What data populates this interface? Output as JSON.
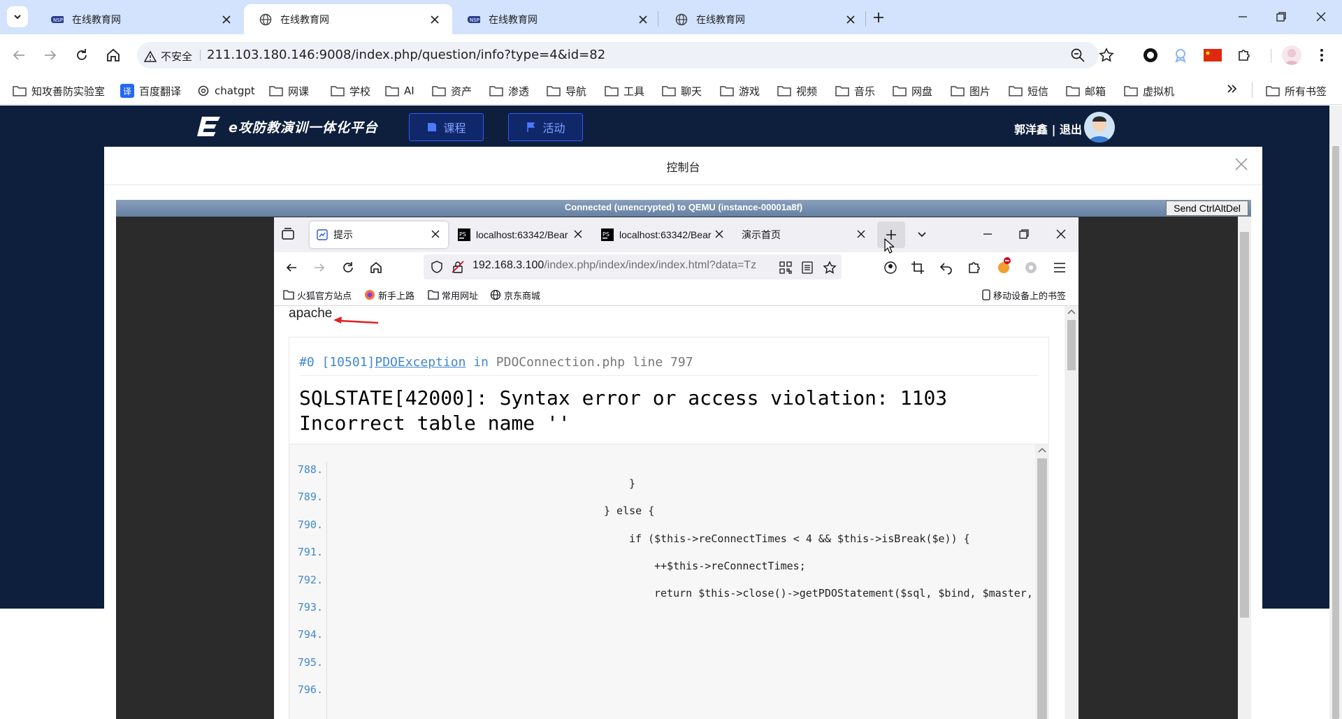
{
  "browser_tabs": [
    {
      "title": "在线教育网",
      "favicon": "nsp-logo-icon",
      "active": false
    },
    {
      "title": "在线教育网",
      "favicon": "globe-icon",
      "active": true
    },
    {
      "title": "在线教育网",
      "favicon": "nsp-logo-icon",
      "active": false
    },
    {
      "title": "在线教育网",
      "favicon": "globe-icon",
      "active": false
    }
  ],
  "address_bar": {
    "security_label": "不安全",
    "url": "211.103.180.146:9008/index.php/question/info?type=4&id=82"
  },
  "bookmarks": [
    "知攻善防实验室",
    "百度翻译",
    "chatgpt",
    "网课",
    "学校",
    "AI",
    "资产",
    "渗透",
    "导航",
    "工具",
    "聊天",
    "游戏",
    "视频",
    "音乐",
    "网盘",
    "图片",
    "短信",
    "邮箱",
    "虚拟机"
  ],
  "bookmarks_all_label": "所有书签",
  "site": {
    "logo_text": "e攻防教演训一体化平台",
    "nav": [
      "课程",
      "活动"
    ],
    "user": "郭洋鑫 | 退出"
  },
  "modal": {
    "title": "控制台"
  },
  "vnc": {
    "status": "Connected (unencrypted) to QEMU (instance-00001a8f)",
    "ctrl_alt_del_label": "Send CtrlAltDel"
  },
  "firefox": {
    "tabs": [
      "提示",
      "localhost:63342/Bear",
      "localhost:63342/Bear",
      "演示首页"
    ],
    "url_host": "192.168.3.100",
    "url_path": "/index.php/index/index/index.html?data=Tz",
    "bookmarks": [
      "火狐官方站点",
      "新手上路",
      "常用网址",
      "京东商城"
    ],
    "mobile_bookmarks_label": "移动设备上的书签"
  },
  "error_page": {
    "output": "apache",
    "exception_prefix": "#0 [10501]",
    "exception_class": "PDOException",
    "exception_in": "in",
    "exception_file": "PDOConnection.php line 797",
    "message_line1": "SQLSTATE[42000]: Syntax error or access violation: 1103",
    "message_line2": "Incorrect table name ''",
    "code_lines": [
      {
        "num": "788.",
        "text": "}",
        "indent": 3
      },
      {
        "num": "789.",
        "text": "",
        "indent": 0
      },
      {
        "num": "790.",
        "text": "} else {",
        "indent": 2
      },
      {
        "num": "791.",
        "text": "",
        "indent": 0
      },
      {
        "num": "792.",
        "text": "if ($this->reConnectTimes < 4 && $this->isBreak($e)) {",
        "indent": 3
      },
      {
        "num": "793.",
        "text": "",
        "indent": 0
      },
      {
        "num": "794.",
        "text": "++$this->reConnectTimes;",
        "indent": 4
      },
      {
        "num": "795.",
        "text": "",
        "indent": 0
      },
      {
        "num": "796.",
        "text": "return $this->close()->getPDOStatement($sql, $bind, $master,",
        "indent": 4
      }
    ]
  }
}
